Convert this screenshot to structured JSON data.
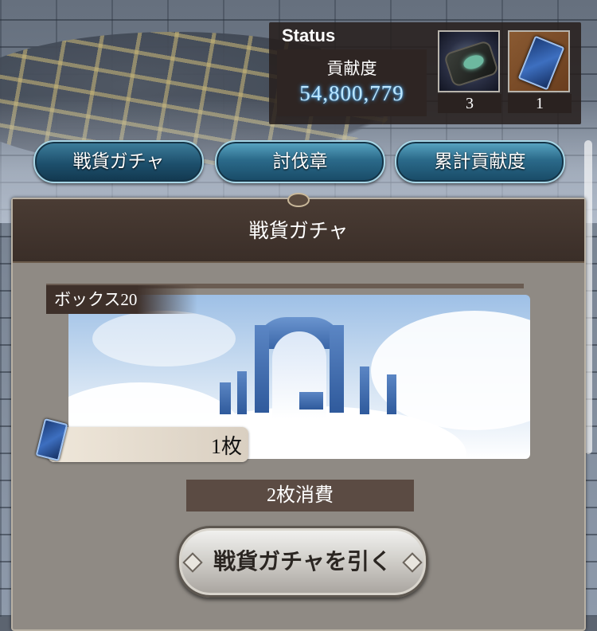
{
  "status": {
    "title": "Status",
    "contribution_label": "貢献度",
    "contribution_value": "54,800,779",
    "items": [
      {
        "icon": "gear-item-icon",
        "count": "3"
      },
      {
        "icon": "blue-ticket-icon",
        "count": "1"
      }
    ]
  },
  "tabs": [
    {
      "label": "戦貨ガチャ",
      "active": true
    },
    {
      "label": "討伐章",
      "active": false
    },
    {
      "label": "累計貢献度",
      "active": false
    }
  ],
  "panel": {
    "title": "戦貨ガチャ",
    "box_label": "ボックス20",
    "ticket_count": "1枚",
    "cost_label": "2枚消費",
    "draw_button": "戦貨ガチャを引く"
  },
  "colors": {
    "tab_gradient": "#2b6a8a",
    "contribution_glow": "#4fb2ff",
    "panel_bg": "#8f8a84",
    "header_bg": "#3a2e28"
  }
}
